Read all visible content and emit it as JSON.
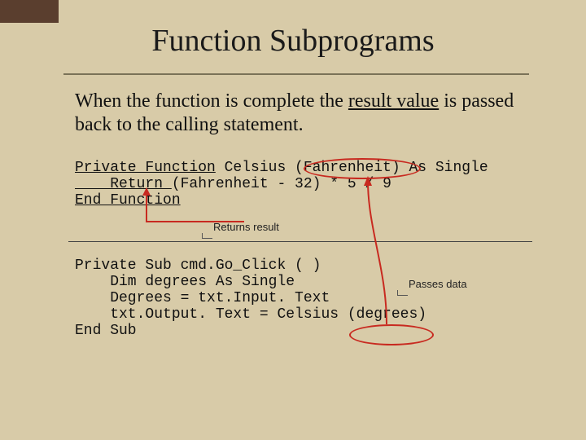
{
  "title": "Function Subprograms",
  "intro": {
    "pre": "When the function is complete the ",
    "mid": "result value",
    "post": " is passed back to the calling statement."
  },
  "code1": {
    "l1a": "Private Function",
    "l1b": " Celsius (Fahrenheit) As Single",
    "l2a": "    Return ",
    "l2b": "(Fahrenheit - 32) * 5 / 9",
    "l3": "End Function"
  },
  "code2": {
    "l1": "Private Sub cmd.Go_Click ( )",
    "l2": "    Dim degrees As Single",
    "l3": "    Degrees = txt.Input. Text",
    "l4": "    txt.Output. Text = Celsius (degrees)",
    "l5": "End Sub"
  },
  "labels": {
    "returns": "Returns result",
    "passes": "Passes data"
  }
}
